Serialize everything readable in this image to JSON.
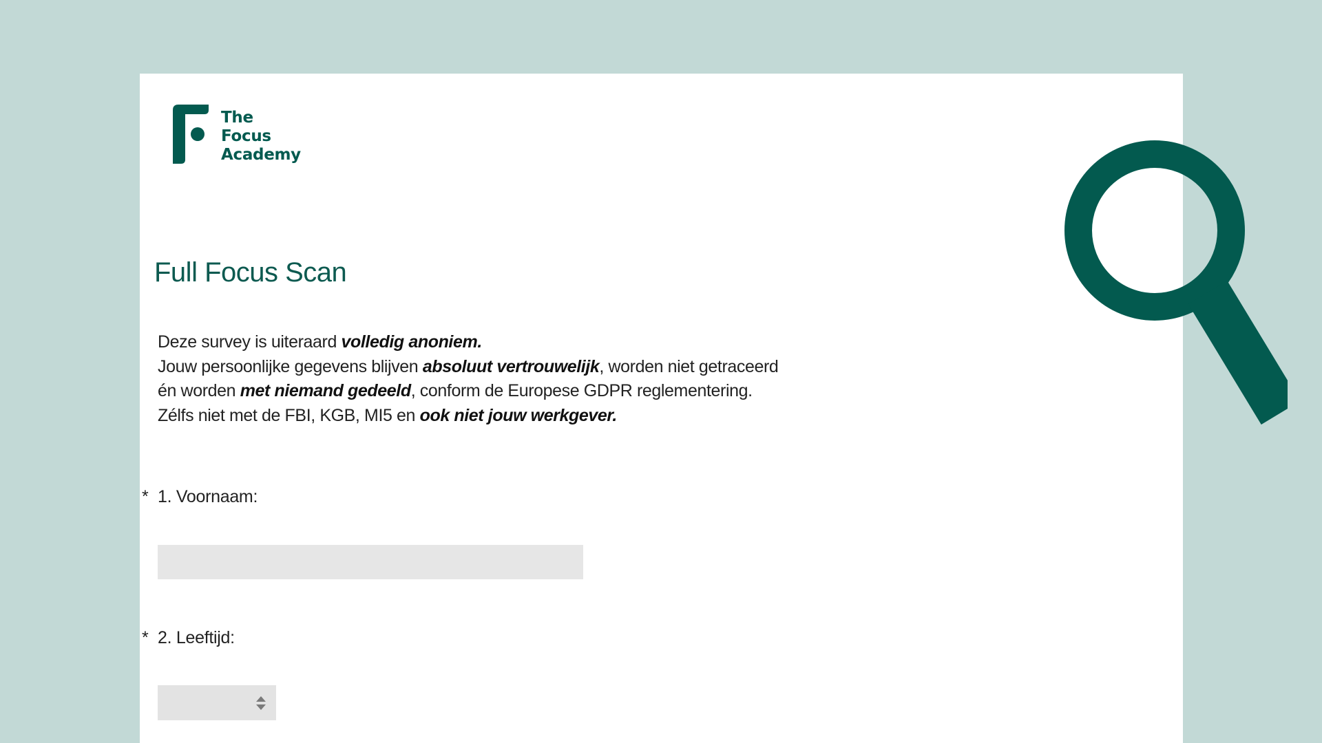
{
  "brand": {
    "logo_lines": [
      "The",
      "Focus",
      "Academy"
    ],
    "color": "#035a4f"
  },
  "survey": {
    "title": "Full Focus Scan",
    "intro": {
      "line1": {
        "normal": "Deze survey is uiteraard ",
        "bold": "volledig anoniem."
      },
      "line2": {
        "normal1": "Jouw persoonlijke gegevens blijven ",
        "bold": "absoluut vertrouwelijk",
        "normal2": ", worden niet getraceerd"
      },
      "line3": {
        "normal1": "én worden ",
        "bold": "met niemand gedeeld",
        "normal2": ", conform de Europese GDPR reglementering."
      },
      "line4": {
        "normal": "Zélfs niet met de FBI, KGB, MI5 en ",
        "bold": "ook niet jouw werkgever."
      }
    },
    "questions": [
      {
        "required_marker": "*",
        "label": "1. Voornaam:",
        "value": ""
      },
      {
        "required_marker": "*",
        "label": "2. Leeftijd:",
        "value": ""
      }
    ]
  },
  "icons": {
    "logo": "focus-academy-logo-icon",
    "magnifier": "magnifying-glass-icon",
    "select_arrows": "select-updown-icon"
  },
  "colors": {
    "background": "#c2d9d6",
    "accent": "#035a4f",
    "input_background": "#e6e6e6"
  }
}
